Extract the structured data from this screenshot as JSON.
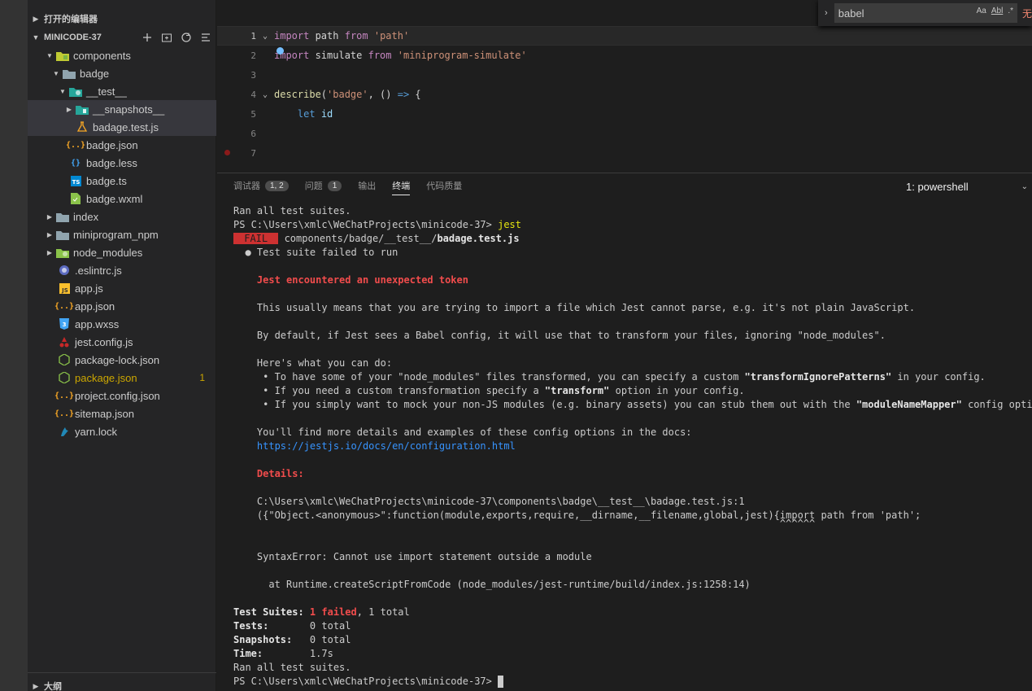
{
  "sidebar": {
    "open_editors_label": "打开的编辑器",
    "project_label": "MINICODE-37",
    "outline_label": "大纲",
    "tree": [
      {
        "label": "components",
        "icon": "folder-components-icon",
        "expanded": true
      },
      {
        "label": "badge",
        "icon": "folder-open-icon",
        "expanded": true
      },
      {
        "label": "__test__",
        "icon": "folder-test-icon",
        "expanded": true
      },
      {
        "label": "__snapshots__",
        "icon": "folder-snapshots-icon",
        "expanded": false
      },
      {
        "label": "badage.test.js",
        "icon": "flask-icon"
      },
      {
        "label": "badge.json",
        "icon": "json-braces-icon"
      },
      {
        "label": "badge.less",
        "icon": "less-braces-icon"
      },
      {
        "label": "badge.ts",
        "icon": "typescript-icon"
      },
      {
        "label": "badge.wxml",
        "icon": "wxml-file-icon"
      },
      {
        "label": "index",
        "icon": "folder-icon",
        "expanded": false
      },
      {
        "label": "miniprogram_npm",
        "icon": "folder-icon",
        "expanded": false
      },
      {
        "label": "node_modules",
        "icon": "folder-node-icon",
        "expanded": false
      },
      {
        "label": ".eslintrc.js",
        "icon": "eslint-icon"
      },
      {
        "label": "app.js",
        "icon": "javascript-icon"
      },
      {
        "label": "app.json",
        "icon": "json-braces-icon"
      },
      {
        "label": "app.wxss",
        "icon": "css-icon"
      },
      {
        "label": "jest.config.js",
        "icon": "jest-icon"
      },
      {
        "label": "package-lock.json",
        "icon": "nodejs-icon"
      },
      {
        "label": "package.json",
        "icon": "nodejs-icon",
        "count": "1"
      },
      {
        "label": "project.config.json",
        "icon": "json-braces-icon"
      },
      {
        "label": "sitemap.json",
        "icon": "json-braces-icon"
      },
      {
        "label": "yarn.lock",
        "icon": "yarn-icon"
      }
    ]
  },
  "editor": {
    "lines": [
      {
        "n": "1",
        "text": "import path from 'path'"
      },
      {
        "n": "2",
        "text": "import simulate from 'miniprogram-simulate'"
      },
      {
        "n": "3",
        "text": ""
      },
      {
        "n": "4",
        "text": "describe('badge', () => {"
      },
      {
        "n": "5",
        "text": "    let id"
      },
      {
        "n": "6",
        "text": ""
      },
      {
        "n": "7",
        "text": ""
      }
    ]
  },
  "find": {
    "value": "babel",
    "opt_case": "Aa",
    "opt_word": "Abl",
    "opt_regex": ".*",
    "result": "无"
  },
  "panel": {
    "tabs": [
      {
        "label": "调试器",
        "count": "1, 2"
      },
      {
        "label": "问题",
        "count": "1"
      },
      {
        "label": "输出"
      },
      {
        "label": "终端",
        "active": true
      },
      {
        "label": "代码质量"
      }
    ],
    "terminal_select": "1: powershell",
    "terminal": {
      "l1": "Ran all test suites.",
      "prompt1": "PS C:\\Users\\xmlc\\WeChatProjects\\minicode-37> ",
      "cmd": "jest",
      "fail": " FAIL ",
      "fail_path": " components/badge/__test__/",
      "fail_file": "badage.test.js",
      "l3": "  ● Test suite failed to run",
      "l4": "    Jest encountered an unexpected token",
      "l5": "    This usually means that you are trying to import a file which Jest cannot parse, e.g. it's not plain JavaScript.",
      "l6": "    By default, if Jest sees a Babel config, it will use that to transform your files, ignoring \"node_modules\".",
      "l7": "    Here's what you can do:",
      "l8a": "     • To have some of your \"node_modules\" files transformed, you can specify a custom ",
      "l8b": "\"transformIgnorePatterns\"",
      "l8c": " in your config.",
      "l9a": "     • If you need a custom transformation specify a ",
      "l9b": "\"transform\"",
      "l9c": " option in your config.",
      "l10a": "     • If you simply want to mock your non-JS modules (e.g. binary assets) you can stub them out with the ",
      "l10b": "\"moduleNameMapper\"",
      "l10c": " config option.",
      "l11": "    You'll find more details and examples of these config options in the docs:",
      "l12": "    https://jestjs.io/docs/en/configuration.html",
      "l13": "    Details:",
      "l14": "    C:\\Users\\xmlc\\WeChatProjects\\minicode-37\\components\\badge\\__test__\\badage.test.js:1",
      "l15": "    ({\"Object.<anonymous>\":function(module,exports,require,__dirname,__filename,global,jest){import path from 'path';",
      "l16": "                                                                                             ^^^^^^",
      "l17": "    SyntaxError: Cannot use import statement outside a module",
      "l18": "      at Runtime.createScriptFromCode (node_modules/jest-runtime/build/index.js:1258:14)",
      "s1a": "Test Suites: ",
      "s1b": "1 failed",
      "s1c": ", 1 total",
      "s2a": "Tests:       ",
      "s2b": "0 total",
      "s3a": "Snapshots:   ",
      "s3b": "0 total",
      "s4a": "Time:        ",
      "s4b": "1.7s",
      "s5": "Ran all test suites.",
      "prompt2": "PS C:\\Users\\xmlc\\WeChatProjects\\minicode-37> "
    }
  }
}
